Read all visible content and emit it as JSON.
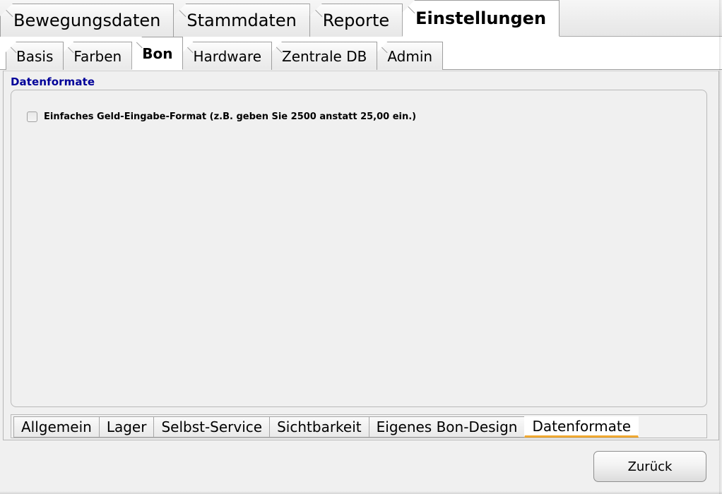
{
  "window": {
    "accent_selected_tab_underline": "#f0a830",
    "group_title_color": "#000099"
  },
  "primary_tabs": [
    {
      "label": "Bewegungsdaten",
      "active": false
    },
    {
      "label": "Stammdaten",
      "active": false
    },
    {
      "label": "Reporte",
      "active": false
    },
    {
      "label": "Einstellungen",
      "active": true
    }
  ],
  "secondary_tabs": [
    {
      "label": "Basis",
      "active": false
    },
    {
      "label": "Farben",
      "active": false
    },
    {
      "label": "Bon",
      "active": true
    },
    {
      "label": "Hardware",
      "active": false
    },
    {
      "label": "Zentrale DB",
      "active": false
    },
    {
      "label": "Admin",
      "active": false
    }
  ],
  "content": {
    "group_title": "Datenformate",
    "checkbox": {
      "label": "Einfaches Geld-Eingabe-Format (z.B. geben Sie 2500 anstatt 25,00 ein.)",
      "checked": false
    }
  },
  "bottom_tabs": [
    {
      "label": "Allgemein",
      "active": false
    },
    {
      "label": "Lager",
      "active": false
    },
    {
      "label": "Selbst-Service",
      "active": false
    },
    {
      "label": "Sichtbarkeit",
      "active": false
    },
    {
      "label": "Eigenes Bon-Design",
      "active": false
    },
    {
      "label": "Datenformate",
      "active": true
    }
  ],
  "footer": {
    "back_label": "Zurück"
  }
}
